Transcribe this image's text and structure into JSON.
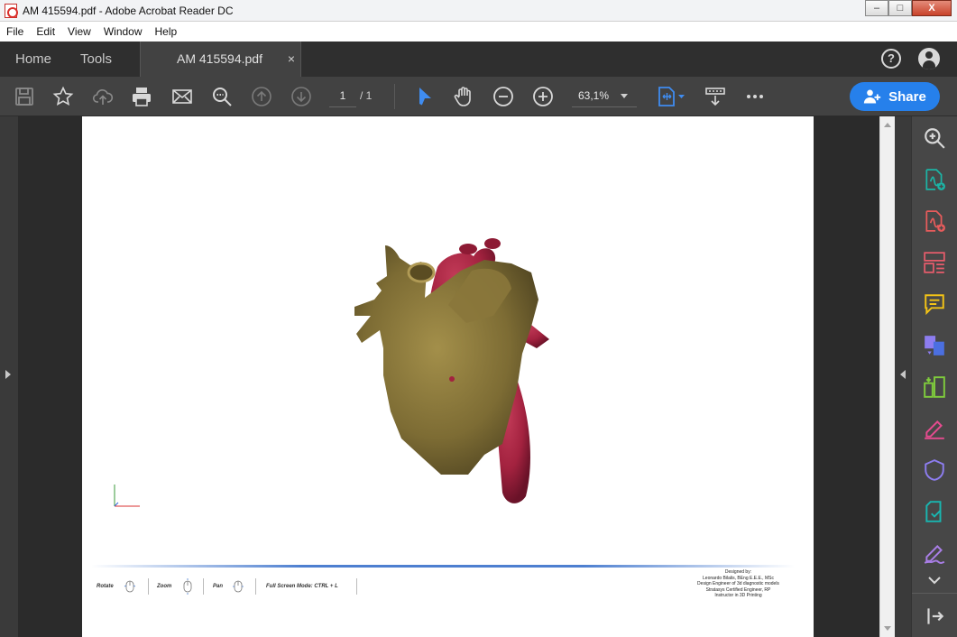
{
  "window": {
    "title": "AM 415594.pdf - Adobe Acrobat Reader DC",
    "controls": {
      "minimize": "–",
      "maximize": "□",
      "close": "X"
    }
  },
  "menu": [
    "File",
    "Edit",
    "View",
    "Window",
    "Help"
  ],
  "tabs": {
    "home": "Home",
    "tools": "Tools",
    "document": "AM 415594.pdf",
    "document_close": "×"
  },
  "header_icons": {
    "help": "?",
    "account": "user-icon"
  },
  "toolbar": {
    "page_current": "1",
    "page_total": "/ 1",
    "zoom": "63,1%",
    "share_label": "Share",
    "share_color": "#2680eb",
    "icons": [
      "save-icon",
      "bookmark-star-icon",
      "upload-cloud-icon",
      "print-icon",
      "email-icon",
      "find-zoom-icon",
      "page-up-icon",
      "page-down-icon",
      "select-cursor-icon",
      "hand-tool-icon",
      "zoom-out-icon",
      "zoom-in-icon",
      "fit-page-icon",
      "scroll-mode-icon",
      "more-icon"
    ]
  },
  "right_panel": {
    "tools": [
      "search-zoom-icon",
      "create-pdf-icon",
      "export-pdf-icon",
      "organize-pages-icon",
      "comment-icon",
      "combine-files-icon",
      "compress-icon",
      "fill-sign-icon",
      "protect-icon",
      "send-for-review-icon",
      "sign-icon"
    ],
    "colors": {
      "create": "#1bb5a6",
      "export": "#e85c5c",
      "organize": "#e85c6c",
      "comment": "#f3c316",
      "combine": "#8d7df0",
      "compress": "#7fcc3c",
      "fill_sign": "#e64b8f",
      "protect": "#8d7df0",
      "review": "#19b6b0",
      "sign": "#a97ee6"
    }
  },
  "page": {
    "controls": [
      {
        "label": "Rotate"
      },
      {
        "label": "Zoom"
      },
      {
        "label": "Pan"
      },
      {
        "label": "Full Screen Mode:  CTRL + L"
      }
    ],
    "credits": [
      "Designed by:",
      "Leonardo Bilalis, BEng E.E.E., MSc",
      "Design Engineer of 3d diagnostic models",
      "Stratasys Certified Engineer, RP",
      "Instructor in 3D Printing"
    ],
    "model_colors": {
      "muscle": "#7d6c34",
      "vessel": "#a3223f"
    }
  }
}
